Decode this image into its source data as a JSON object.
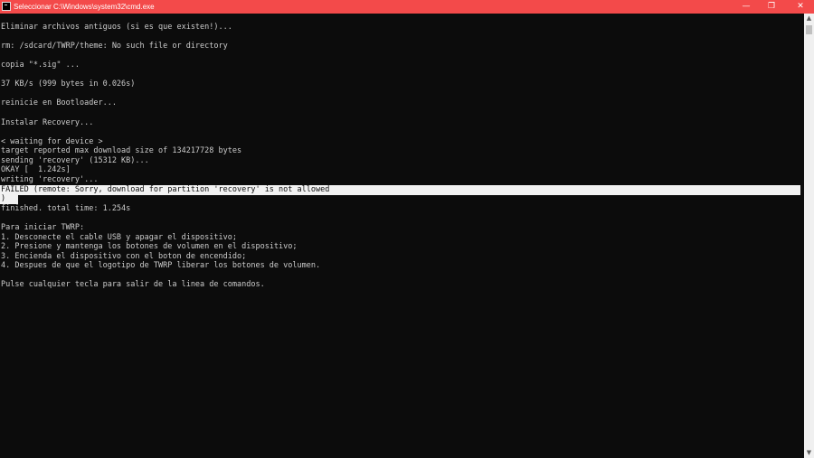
{
  "window": {
    "title": "Seleccionar C:\\Windows\\system32\\cmd.exe",
    "icon": "cmd-icon",
    "controls": {
      "minimize": "—",
      "restore": "❐",
      "close": "✕"
    },
    "titlebar_color": "#f34a4a",
    "background_color": "#0c0c0c",
    "text_color": "#cccccc"
  },
  "console": {
    "lines": [
      "Eliminar archivos antiguos (si es que existen!)...",
      "",
      "rm: /sdcard/TWRP/theme: No such file or directory",
      "",
      "copia \"*.sig\" ...",
      "",
      "37 KB/s (999 bytes in 0.026s)",
      "",
      "reinicie en Bootloader...",
      "",
      "Instalar Recovery...",
      "",
      "< waiting for device >",
      "target reported max download size of 134217728 bytes",
      "sending 'recovery' (15312 KB)...",
      "OKAY [  1.242s]",
      "writing 'recovery'...",
      "FAILED (remote: Sorry, download for partition 'recovery' is not allowed",
      ")",
      "finished. total time: 1.254s",
      "",
      "Para iniciar TWRP:",
      "1. Desconecte el cable USB y apagar el dispositivo;",
      "2. Presione y mantenga los botones de volumen en el dispositivo;",
      "3. Encienda el dispositivo con el boton de encendido;",
      "4. Despues de que el logotipo de TWRP liberar los botones de volumen.",
      "",
      "Pulse cualquier tecla para salir de la linea de comandos."
    ],
    "selected_lines": [
      17,
      18
    ]
  },
  "scrollbar": {
    "up": "▲",
    "down": "▼"
  }
}
